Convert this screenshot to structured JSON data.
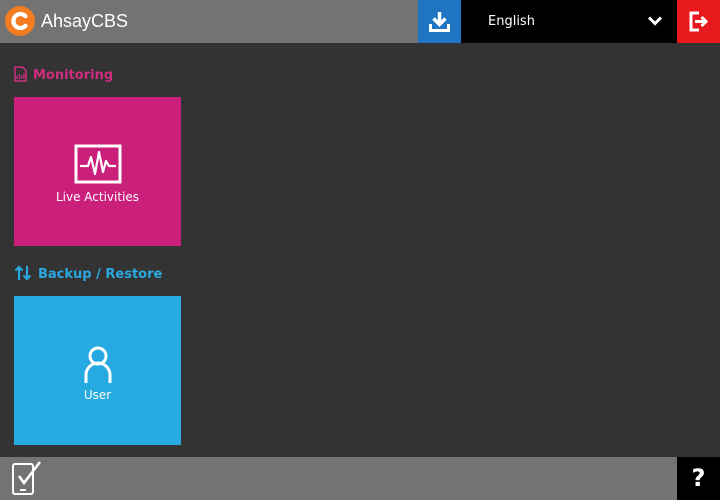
{
  "header": {
    "app_title": "AhsayCBS",
    "logo_icon": "ahsay-logo-icon",
    "download_icon": "download-icon",
    "language": {
      "selected": "English",
      "chevron_icon": "chevron-down-icon"
    },
    "logout_icon": "logout-icon"
  },
  "sections": {
    "monitoring": {
      "title": "Monitoring",
      "icon": "report-icon",
      "tiles": [
        {
          "label": "Live Activities",
          "icon": "live-activity-icon"
        }
      ]
    },
    "backup_restore": {
      "title": "Backup / Restore",
      "icon": "sync-arrows-icon",
      "tiles": [
        {
          "label": "User",
          "icon": "user-icon"
        }
      ]
    }
  },
  "footer": {
    "tasks_icon": "task-checklist-icon",
    "help_label": "?"
  },
  "colors": {
    "header_bg": "#737373",
    "body_bg": "#333333",
    "download_bg": "#1f75c2",
    "logout_bg": "#e8191d",
    "monitoring_accent": "#cb1f7c",
    "backup_accent": "#27a9e1",
    "logo_orange": "#f37b20"
  }
}
